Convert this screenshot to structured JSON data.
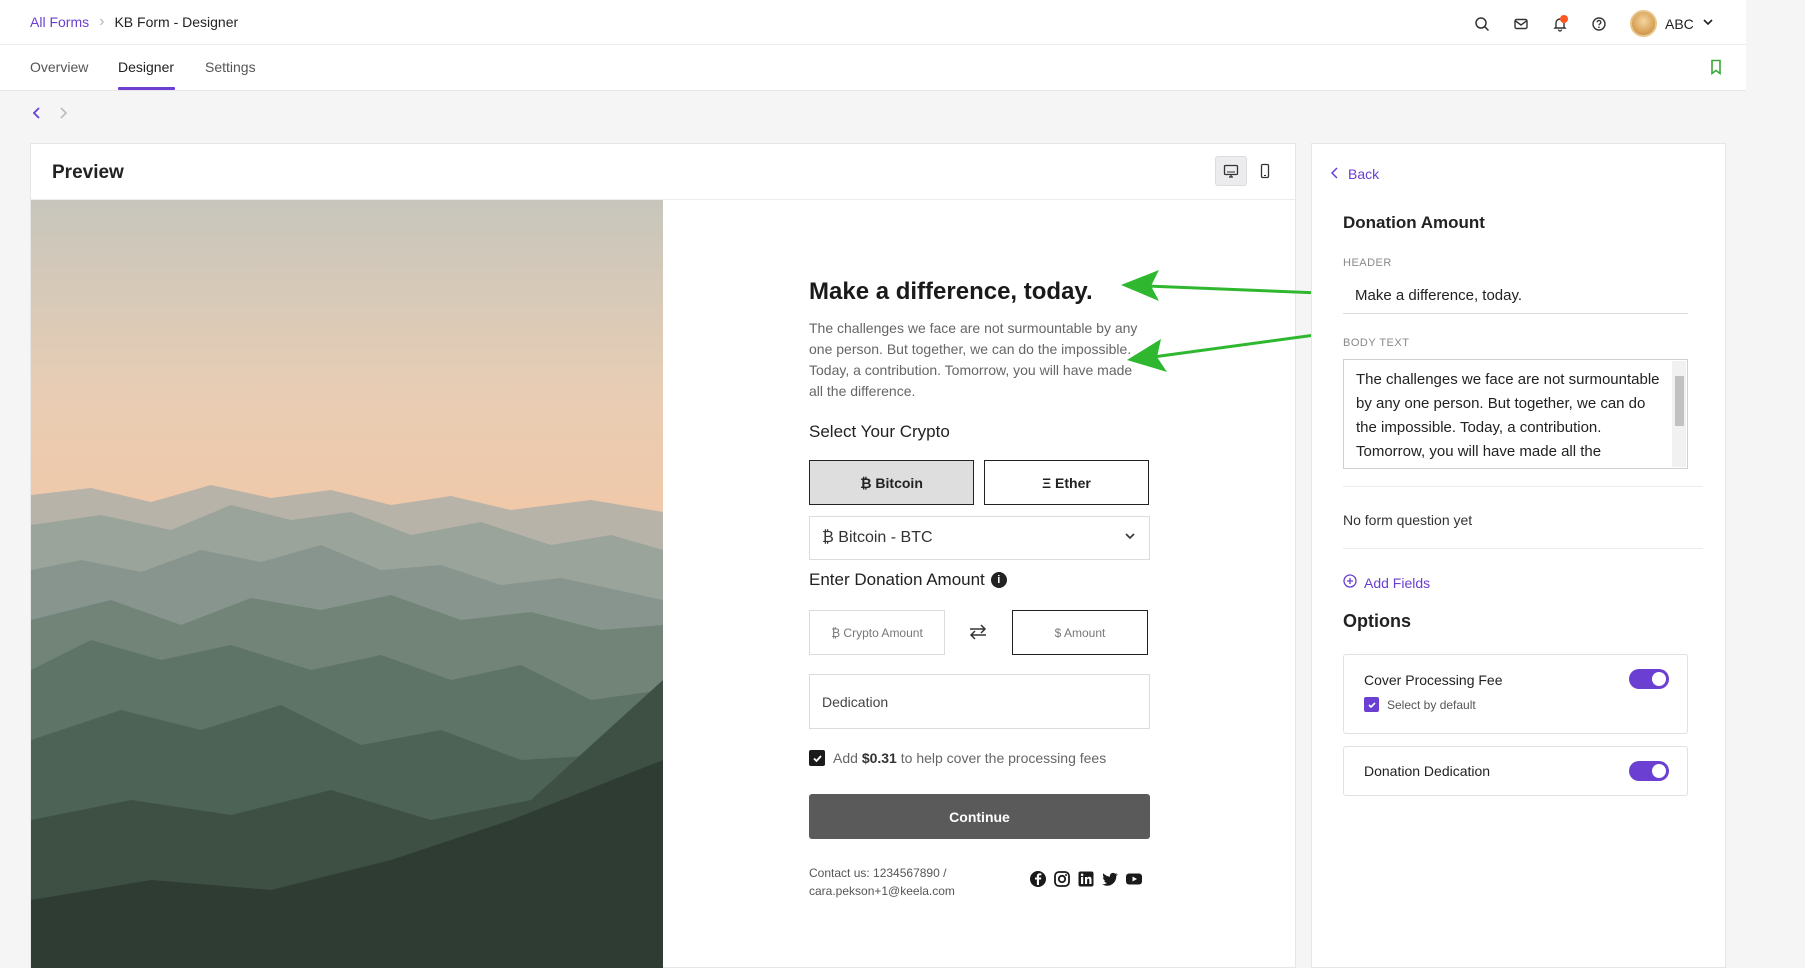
{
  "breadcrumb": {
    "root": "All Forms",
    "current": "KB Form - Designer"
  },
  "user": {
    "name": "ABC"
  },
  "tabs": [
    {
      "label": "Overview"
    },
    {
      "label": "Designer"
    },
    {
      "label": "Settings"
    }
  ],
  "preview": {
    "title": "Preview",
    "form": {
      "header": "Make a difference, today.",
      "body": "The challenges we face are not surmountable by any one person. But together, we can do the impossible. Today, a contribution. Tomorrow, you will have made all the difference.",
      "select_crypto_label": "Select Your Crypto",
      "crypto_options": [
        "₿ Bitcoin",
        "Ξ Ether"
      ],
      "selected_crypto": "₿ Bitcoin - BTC",
      "donation_amount_label": "Enter Donation Amount",
      "crypto_amount_placeholder": "₿ Crypto Amount",
      "usd_amount_placeholder": "$ Amount",
      "dedication_placeholder": "Dedication",
      "fee_prefix": "Add ",
      "fee_amount": "$0.31",
      "fee_suffix": " to help cover the processing fees",
      "continue_label": "Continue",
      "contact_line1": "Contact us: 1234567890 /",
      "contact_line2": "cara.pekson+1@keela.com"
    }
  },
  "panel": {
    "back_label": "Back",
    "title": "Donation Amount",
    "header_label": "HEADER",
    "header_value": "Make a difference, today.",
    "body_label": "BODY TEXT",
    "body_value": "The challenges we face are not surmountable by any one person. But together, we can do the impossible. Today, a contribution. Tomorrow, you will have made all the difference.",
    "no_question": "No form question yet",
    "add_fields": "Add Fields",
    "options_title": "Options",
    "options": {
      "cover_fee_label": "Cover Processing Fee",
      "select_default_label": "Select by default",
      "dedication_label": "Donation Dedication"
    }
  },
  "colors": {
    "accent": "#6a3fd1",
    "annotation_arrow": "#2fb82f",
    "notification_dot": "#ff5722",
    "continue_button": "#5a5a5a"
  },
  "icons": [
    "search-icon",
    "mail-icon",
    "bell-icon",
    "help-icon",
    "chevron-down-icon",
    "bookmark-icon",
    "desktop-icon",
    "mobile-icon",
    "info-icon",
    "swap-icon",
    "facebook-icon",
    "instagram-icon",
    "linkedin-icon",
    "twitter-icon",
    "youtube-icon",
    "plus-circle-icon"
  ]
}
